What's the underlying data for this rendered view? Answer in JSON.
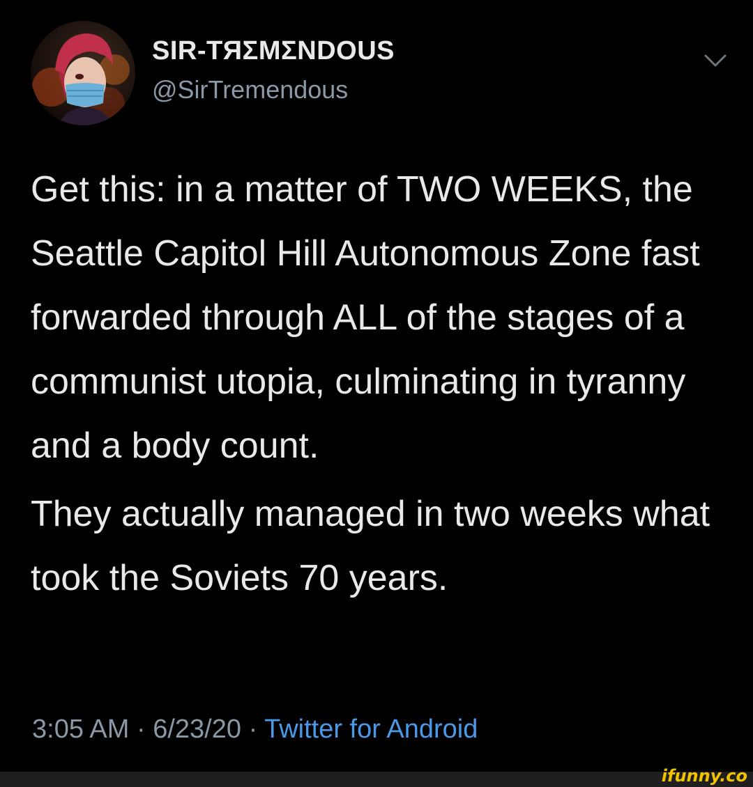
{
  "tweet": {
    "display_name": "SIR-TЯΣMΣNDOUS",
    "handle": "@SirTremendous",
    "avatar_icon": "user-avatar-red-hair-mask",
    "menu_icon": "chevron-down-icon",
    "paragraphs": [
      "Get this: in a matter of TWO WEEKS, the Seattle Capitol Hill Autonomous Zone fast forwarded through ALL of the stages of a communist utopia, culminating in tyranny and a body count.",
      "They actually managed in two weeks what took the Soviets 70 years."
    ],
    "time": "3:05 AM",
    "date": "6/23/20",
    "separator": "·",
    "source": "Twitter for Android"
  },
  "watermark": "ifunny.co",
  "colors": {
    "background": "#000000",
    "text": "#e7e9ea",
    "muted": "#8b98a5",
    "link": "#4a99e9",
    "watermark": "#f2c200"
  }
}
